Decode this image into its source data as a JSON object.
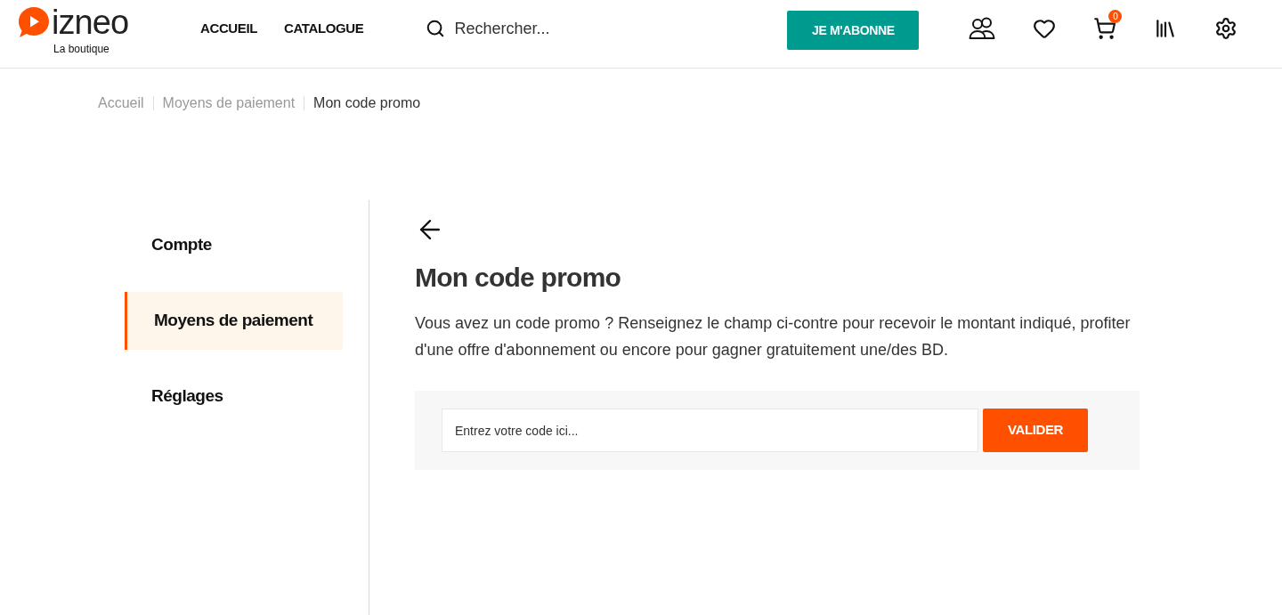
{
  "header": {
    "logo": {
      "wordmark": "izneo",
      "tagline": "La boutique"
    },
    "nav": [
      {
        "label": "ACCUEIL"
      },
      {
        "label": "CATALOGUE"
      }
    ],
    "search": {
      "placeholder": "Rechercher..."
    },
    "subscribe_button": "JE M'ABONNE",
    "cart": {
      "count": "0"
    }
  },
  "breadcrumb": [
    {
      "label": "Accueil",
      "current": false
    },
    {
      "label": "Moyens de paiement",
      "current": false
    },
    {
      "label": "Mon code promo",
      "current": true
    }
  ],
  "sidebar": {
    "items": [
      {
        "label": "Compte",
        "selected": false
      },
      {
        "label": "Moyens de paiement",
        "selected": true
      },
      {
        "label": "Réglages",
        "selected": false
      }
    ]
  },
  "content": {
    "title": "Mon code promo",
    "description": "Vous avez un code promo ? Renseignez le champ ci-contre pour recevoir le montant indiqué, profiter d'une offre d'abonnement ou encore pour gagner gratuitement une/des BD.",
    "promo": {
      "placeholder": "Entrez votre code ici...",
      "button": "VALIDER"
    }
  }
}
